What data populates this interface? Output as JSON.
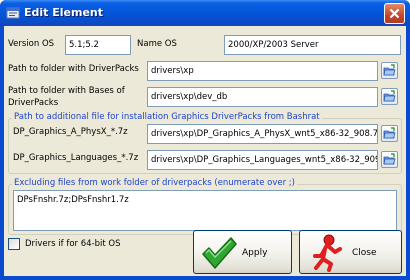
{
  "window": {
    "title": "Edit Element",
    "close_symbol": "×"
  },
  "os": {
    "version_label": "Version OS",
    "version_value": "5.1;5.2",
    "name_label": "Name OS",
    "name_value": "2000/XP/2003 Server"
  },
  "paths": {
    "driverpacks_label": "Path to folder with DriverPacks",
    "driverpacks_value": "drivers\\xp",
    "bases_label_line1": "Path to folder with Bases of",
    "bases_label_line2": "DriverPacks",
    "bases_value": "drivers\\xp\\dev_db"
  },
  "bashrat": {
    "group_title": "Path to additional file for installation Graphics DriverPacks from Bashrat",
    "physx_label": "DP_Graphics_A_PhysX_*.7z",
    "physx_value": "drivers\\xp\\DP_Graphics_A_PhysX_wnt5_x86-32_908.7z",
    "languages_label": "DP_Graphics_Languages_*.7z",
    "languages_value": "drivers\\xp\\DP_Graphics_Languages_wnt5_x86-32_9090"
  },
  "excluding": {
    "group_title": "Excluding files from work folder of driverpacks (enumerate over ;)",
    "value": "DPsFnshr.7z;DPsFnshr1.7z"
  },
  "options": {
    "x64_label": "Drivers if for 64-bit OS",
    "x64_checked": false
  },
  "buttons": {
    "apply_label": "Apply",
    "close_label": "Close"
  },
  "icons": {
    "app": "settings-window-icon",
    "browse": "open-folder-icon",
    "apply": "green-checkmark-icon",
    "close": "running-man-exit-icon"
  }
}
